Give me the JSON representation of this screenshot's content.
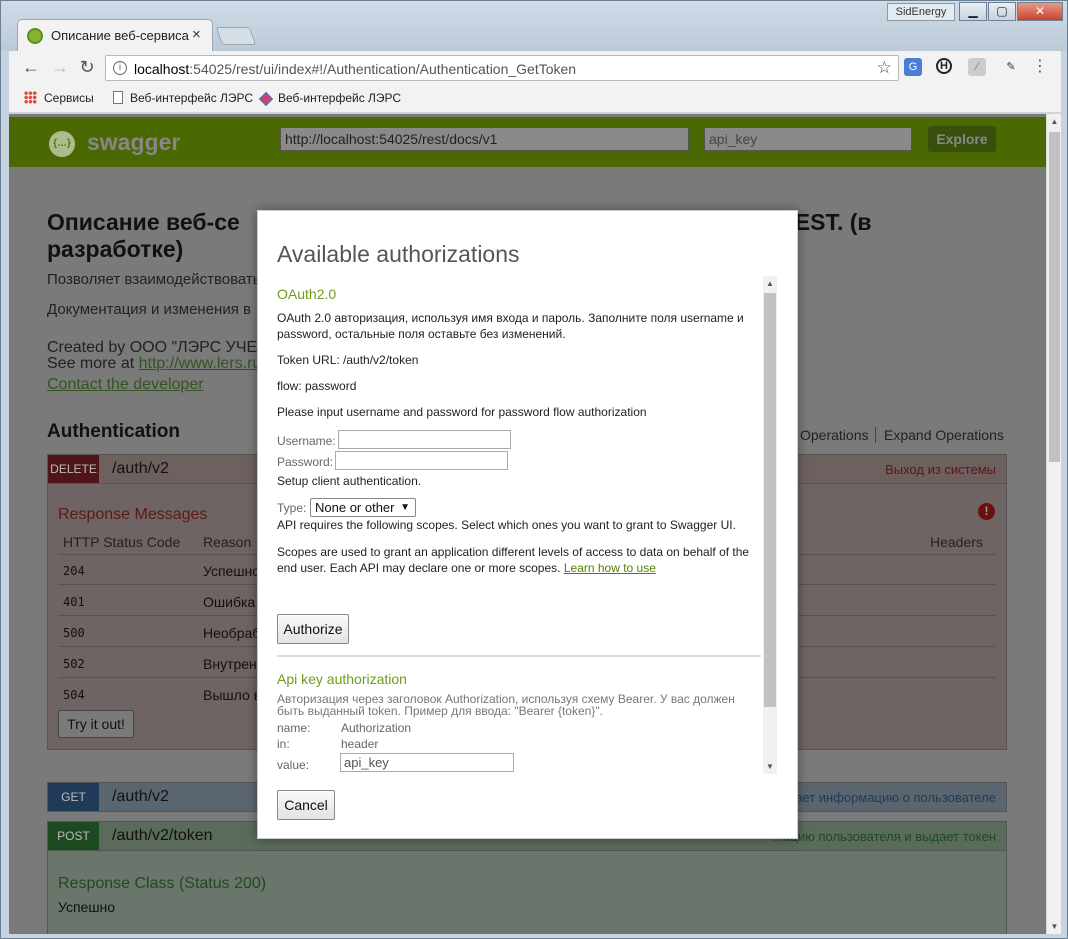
{
  "window": {
    "tab_title": "Описание веб-сервиса",
    "tab_close": "×",
    "profile_name": "SidEnergy",
    "btn_min": "▁",
    "btn_max": "▢",
    "btn_close": "✕"
  },
  "toolbar": {
    "back": "←",
    "forward": "→",
    "reload": "↻",
    "url_host": "localhost",
    "url_rest": ":54025/rest/ui/index#!/Authentication/Authentication_GetToken",
    "star": "☆",
    "menu": "⋮"
  },
  "bookmarks": {
    "items": [
      "Сервисы",
      "Веб-интерфейс ЛЭРС",
      "Веб-интерфейс ЛЭРС"
    ]
  },
  "swagger": {
    "brand": "swagger",
    "logo_glyph": "{…}",
    "spec_url": "http://localhost:54025/rest/docs/v1",
    "api_key_placeholder": "api_key",
    "explore_label": "Explore"
  },
  "page": {
    "title_left": "Описание веб-се",
    "title_right": "EST. (в",
    "title_line2": "разработке)",
    "desc_1": "Позволяет взаимодействовать",
    "desc_2": "Документация и изменения в",
    "created_by": "Created by ООО \"ЛЭРС УЧЕ",
    "see_more_prefix": "See more at ",
    "see_more_link": "http://www.lers.ru",
    "contact": "Contact the developer",
    "section_title": "Authentication",
    "list_operations": "Operations",
    "expand_operations": "Expand Operations"
  },
  "endpoints": {
    "delete": {
      "verb": "DELETE",
      "path": "/auth/v2",
      "summary": "Выход из системы"
    },
    "get": {
      "verb": "GET",
      "path": "/auth/v2",
      "summary": "ает информацию о пользователе"
    },
    "post": {
      "verb": "POST",
      "path": "/auth/v2/token",
      "summary": "...ацию пользователя и выдает токен"
    }
  },
  "response_messages": {
    "heading": "Response Messages",
    "alert_glyph": "!",
    "col_code": "HTTP Status Code",
    "col_reason": "Reason",
    "col_headers": "Headers",
    "rows": [
      {
        "code": "204",
        "reason": "Успешно"
      },
      {
        "code": "401",
        "reason": "Ошибка"
      },
      {
        "code": "500",
        "reason": "Необраб"
      },
      {
        "code": "502",
        "reason": "Внутренн"
      },
      {
        "code": "504",
        "reason": "Вышло в"
      }
    ],
    "try_label": "Try it out!"
  },
  "response_class": {
    "heading": "Response Class (Status 200)",
    "value": "Успешно"
  },
  "modal": {
    "title": "Available authorizations",
    "oauth": {
      "heading": "OAuth2.0",
      "description": "OAuth 2.0 авторизация, используя имя входа и пароль. Заполните поля username и password, остальные поля оставьте без изменений.",
      "token_url": "Token URL: /auth/v2/token",
      "flow": "flow: password",
      "prompt": "Please input username and password for password flow authorization",
      "username_label": "Username:",
      "password_label": "Password:",
      "setup": "Setup client authentication.",
      "type_label": "Type:",
      "type_value": "None or other",
      "scopes_req": "API requires the following scopes. Select which ones you want to grant to Swagger UI.",
      "scopes_desc": "Scopes are used to grant an application different levels of access to data on behalf of the end user. Each API may declare one or more scopes.",
      "learn_link": "Learn how to use",
      "authorize_label": "Authorize"
    },
    "apikey": {
      "heading": "Api key authorization",
      "description": "Авторизация через заголовок Authorization, используя схему Bearer. У вас должен быть выданный token. Пример для ввода: \"Bearer {token}\".",
      "name_key": "name:",
      "name_val": "Authorization",
      "in_key": "in:",
      "in_val": "header",
      "value_key": "value:",
      "value_placeholder": "api_key"
    },
    "cancel_label": "Cancel"
  }
}
